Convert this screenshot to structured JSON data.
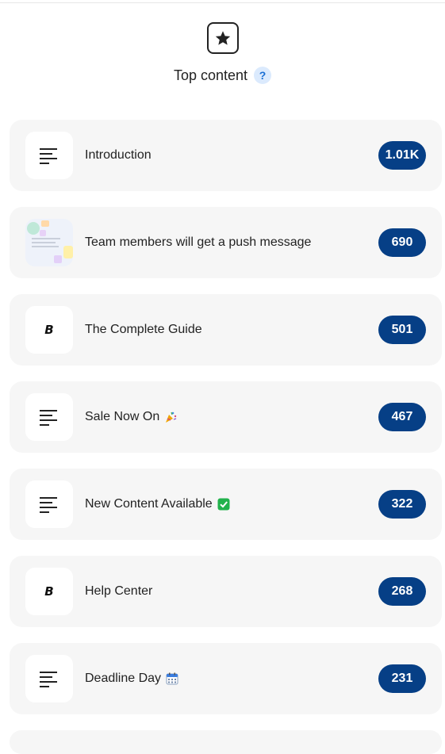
{
  "header": {
    "title": "Top content",
    "help": "?",
    "icon": "star-icon"
  },
  "items": [
    {
      "label": "Introduction",
      "count": "1.01K",
      "icon": "text-lines-icon"
    },
    {
      "label": "Team members will get a push message",
      "count": "690",
      "icon": "image-thumbnail-icon"
    },
    {
      "label": "The Complete Guide",
      "count": "501",
      "icon": "b-logo-icon",
      "glyph": "B"
    },
    {
      "label": "Sale Now On",
      "count": "467",
      "icon": "text-lines-icon",
      "emoji": "party-popper-icon"
    },
    {
      "label": "New Content Available",
      "count": "322",
      "icon": "text-lines-icon",
      "emoji": "check-mark-icon"
    },
    {
      "label": "Help Center",
      "count": "268",
      "icon": "b-logo-icon",
      "glyph": "B"
    },
    {
      "label": "Deadline Day",
      "count": "231",
      "icon": "text-lines-icon",
      "emoji": "calendar-icon"
    }
  ],
  "colors": {
    "badge": "#063f86",
    "card": "#f6f6f6",
    "help_bg": "#dbeafd",
    "help_fg": "#1a6fd4"
  }
}
